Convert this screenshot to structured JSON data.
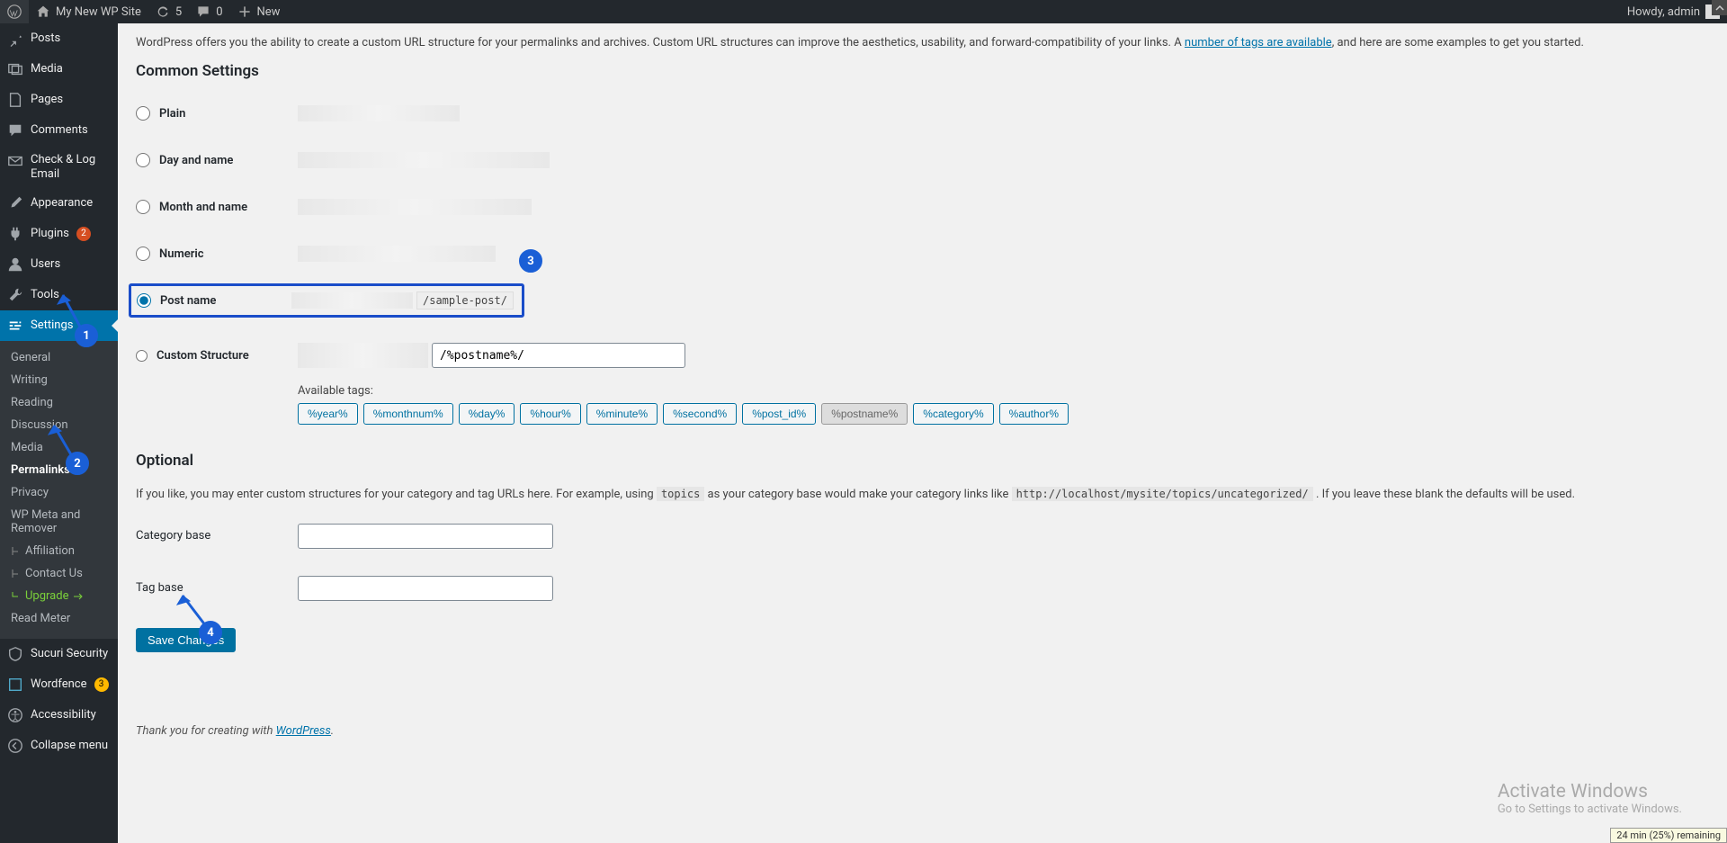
{
  "adminbar": {
    "site_name": "My New WP Site",
    "updates_count": "5",
    "comments_count": "0",
    "new_label": "New",
    "howdy": "Howdy, admin"
  },
  "sidebar": {
    "posts": "Posts",
    "media": "Media",
    "pages": "Pages",
    "comments": "Comments",
    "check_email": "Check & Log Email",
    "appearance": "Appearance",
    "plugins": "Plugins",
    "plugins_badge": "2",
    "users": "Users",
    "tools": "Tools",
    "settings": "Settings",
    "sucuri": "Sucuri Security",
    "wordfence": "Wordfence",
    "wordfence_badge": "3",
    "accessibility": "Accessibility",
    "collapse": "Collapse menu",
    "sub": {
      "general": "General",
      "writing": "Writing",
      "reading": "Reading",
      "discussion": "Discussion",
      "media": "Media",
      "permalinks": "Permalinks",
      "privacy": "Privacy",
      "wpmeta": "WP Meta and Remover",
      "readmeter": "Read Meter",
      "affiliation": "Affiliation",
      "contact": "Contact Us",
      "upgrade": "Upgrade"
    }
  },
  "main": {
    "intro_before": "WordPress offers you the ability to create a custom URL structure for your permalinks and archives. Custom URL structures can improve the aesthetics, usability, and forward-compatibility of your links. A ",
    "intro_link": "number of tags are available",
    "intro_after": ", and here are some examples to get you started.",
    "heading": "Common Settings",
    "opt_plain": "Plain",
    "opt_day_name": "Day and name",
    "opt_month_name": "Month and name",
    "opt_numeric": "Numeric",
    "opt_post_name": "Post name",
    "sample_suffix": "/sample-post/",
    "opt_custom": "Custom Structure",
    "custom_val": "/%postname%/",
    "available_tags": "Available tags:",
    "tags": [
      {
        "label": "%year%",
        "active": false
      },
      {
        "label": "%monthnum%",
        "active": false
      },
      {
        "label": "%day%",
        "active": false
      },
      {
        "label": "%hour%",
        "active": false
      },
      {
        "label": "%minute%",
        "active": false
      },
      {
        "label": "%second%",
        "active": false
      },
      {
        "label": "%post_id%",
        "active": false
      },
      {
        "label": "%postname%",
        "active": true
      },
      {
        "label": "%category%",
        "active": false
      },
      {
        "label": "%author%",
        "active": false
      }
    ],
    "optional_heading": "Optional",
    "optional_text_before": "If you like, you may enter custom structures for your category and tag URLs here. For example, using ",
    "optional_code1": "topics",
    "optional_text_mid": " as your category base would make your category links like ",
    "optional_code2": "http://localhost/mysite/topics/uncategorized/",
    "optional_text_after": " . If you leave these blank the defaults will be used.",
    "cat_base": "Category base",
    "tag_base": "Tag base",
    "save_btn": "Save Changes",
    "footer_before": "Thank you for creating with ",
    "footer_link": "WordPress",
    "activate_title": "Activate Windows",
    "activate_sub": "Go to Settings to activate Windows.",
    "battery": "24 min (25%) remaining"
  },
  "markers": {
    "m1": "1",
    "m2": "2",
    "m3": "3",
    "m4": "4"
  }
}
